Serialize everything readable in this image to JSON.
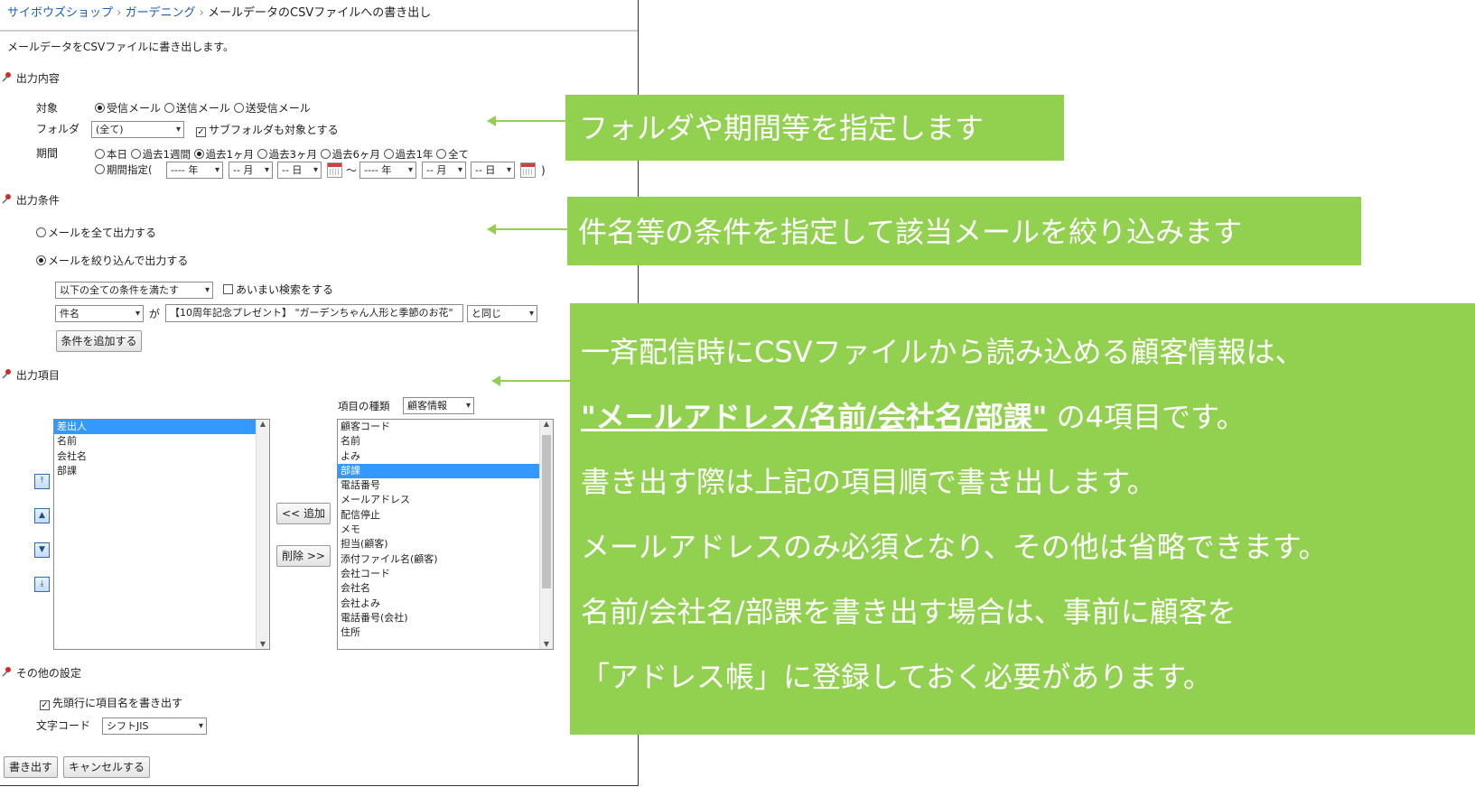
{
  "breadcrumb": {
    "items": [
      "サイボウズショップ",
      "ガーデニング"
    ],
    "current": "メールデータのCSVファイルへの書き出し",
    "separator": "›"
  },
  "description": "メールデータをCSVファイルに書き出します。",
  "section_content": {
    "title": "出力内容",
    "target_label": "対象",
    "target_options": [
      "受信メール",
      "送信メール",
      "送受信メール"
    ],
    "folder_label": "フォルダ",
    "folder_value": "(全て)",
    "subfolder_label": "サブフォルダも対象とする",
    "period_label": "期間",
    "period_options": [
      "本日",
      "過去1週間",
      "過去1ヶ月",
      "過去3ヶ月",
      "過去6ヶ月",
      "過去1年",
      "全て"
    ],
    "period_custom_label": "期間指定(",
    "period_close": ")",
    "year_placeholder": "---- 年",
    "month_placeholder": "-- 月",
    "day_placeholder": "-- 日",
    "tilde": "～"
  },
  "section_condition": {
    "title": "出力条件",
    "option_all": "メールを全て出力する",
    "option_filter": "メールを絞り込んで出力する",
    "match_value": "以下の全ての条件を満たす",
    "fuzzy_label": "あいまい検索をする",
    "field_value": "件名",
    "ga": "が",
    "keyword_value": "【10周年記念プレゼント】 \"ガーデンちゃん人形と季節のお花\"",
    "operator_value": "と同じ",
    "add_condition": "条件を追加する"
  },
  "section_items": {
    "title": "出力項目",
    "selected_items": [
      "差出人",
      "名前",
      "会社名",
      "部課"
    ],
    "kind_label": "項目の種類",
    "kind_value": "顧客情報",
    "available_items": [
      "顧客コード",
      "名前",
      "よみ",
      "部課",
      "電話番号",
      "メールアドレス",
      "配信停止",
      "メモ",
      "担当(顧客)",
      "添付ファイル名(顧客)",
      "会社コード",
      "会社名",
      "会社よみ",
      "電話番号(会社)",
      "住所"
    ],
    "add_button": "<< 追加",
    "remove_button": "削除 >>"
  },
  "section_other": {
    "title": "その他の設定",
    "header_row_label": "先頭行に項目名を書き出す",
    "encoding_label": "文字コード",
    "encoding_value": "シフトJIS"
  },
  "actions": {
    "export": "書き出す",
    "cancel": "キャンセルする"
  },
  "callouts": {
    "c1": "フォルダや期間等を指定します",
    "c2": "件名等の条件を指定して該当メールを絞り込みます",
    "c3_line1": "一斉配信時にCSVファイルから読み込める顧客情報は、",
    "c3_bold": "\"メールアドレス/名前/会社名/部課\"",
    "c3_line2_rest": "の4項目です。",
    "c3_line3": "書き出す際は上記の項目順で書き出します。",
    "c3_line4": "メールアドレスのみ必須となり、その他は省略できます。",
    "c3_line5": "名前/会社名/部課を書き出す場合は、事前に顧客を",
    "c3_line6": "「アドレス帳」に登録しておく必要があります。"
  },
  "colors": {
    "callout": "#92d050",
    "link": "#1a5fb4",
    "selection": "#3399ff"
  }
}
